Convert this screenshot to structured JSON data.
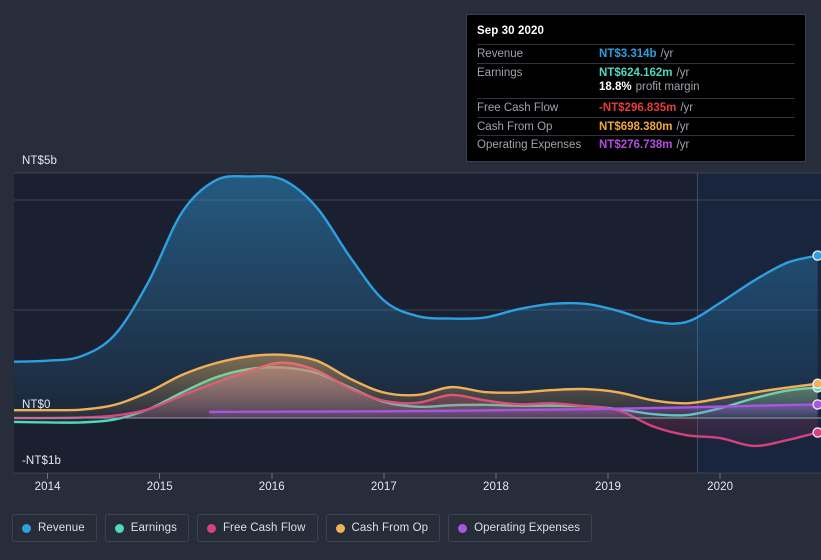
{
  "chart_data": {
    "type": "area",
    "title": "",
    "xlabel": "",
    "ylabel": "",
    "currency": "NT$",
    "grid": true,
    "legend_position": "bottom",
    "x_ticks": [
      "2014",
      "2015",
      "2016",
      "2017",
      "2018",
      "2019",
      "2020"
    ],
    "y_ticks": [
      "NT$5b",
      "NT$0",
      "-NT$1b"
    ],
    "ylim": [
      -1.0,
      5.0
    ],
    "xlim": [
      2013.7,
      2020.9
    ],
    "forecast_divider_x": "2019.8",
    "series": [
      {
        "name": "Revenue",
        "color": "#2e9fe0",
        "x": [
          2013.7,
          2014.0,
          2014.3,
          2014.6,
          2014.9,
          2015.2,
          2015.5,
          2015.8,
          2016.1,
          2016.4,
          2016.7,
          2017.0,
          2017.3,
          2017.6,
          2017.9,
          2018.2,
          2018.5,
          2018.8,
          2019.1,
          2019.4,
          2019.7,
          2020.0,
          2020.3,
          2020.6,
          2020.87
        ],
        "values": [
          1.15,
          1.17,
          1.26,
          1.7,
          2.78,
          4.2,
          4.85,
          4.93,
          4.86,
          4.3,
          3.28,
          2.4,
          2.08,
          2.03,
          2.05,
          2.22,
          2.33,
          2.33,
          2.18,
          1.97,
          1.96,
          2.35,
          2.8,
          3.17,
          3.314
        ],
        "end_value": 3.314
      },
      {
        "name": "Earnings",
        "color": "#4fd8bd",
        "x": [
          2013.7,
          2014.0,
          2014.3,
          2014.6,
          2014.9,
          2015.2,
          2015.5,
          2015.8,
          2016.1,
          2016.4,
          2016.7,
          2017.0,
          2017.3,
          2017.6,
          2017.9,
          2018.2,
          2018.5,
          2018.8,
          2019.1,
          2019.4,
          2019.7,
          2020.0,
          2020.3,
          2020.6,
          2020.87
        ],
        "values": [
          -0.08,
          -0.09,
          -0.09,
          -0.03,
          0.18,
          0.52,
          0.83,
          1.0,
          1.03,
          0.92,
          0.62,
          0.33,
          0.23,
          0.26,
          0.27,
          0.25,
          0.25,
          0.24,
          0.18,
          0.08,
          0.06,
          0.2,
          0.4,
          0.56,
          0.624162
        ],
        "end_value": 0.624162
      },
      {
        "name": "Free Cash Flow",
        "color": "#d6407f",
        "x": [
          2013.7,
          2014.0,
          2014.3,
          2014.6,
          2014.9,
          2015.2,
          2015.5,
          2015.8,
          2016.1,
          2016.4,
          2016.7,
          2017.0,
          2017.3,
          2017.6,
          2017.9,
          2018.2,
          2018.5,
          2018.8,
          2019.1,
          2019.4,
          2019.7,
          2020.0,
          2020.3,
          2020.6,
          2020.87
        ],
        "values": [
          0.0,
          0.0,
          0.01,
          0.05,
          0.18,
          0.46,
          0.72,
          0.96,
          1.13,
          0.97,
          0.6,
          0.35,
          0.31,
          0.47,
          0.36,
          0.28,
          0.3,
          0.24,
          0.15,
          -0.17,
          -0.35,
          -0.41,
          -0.57,
          -0.45,
          -0.296835
        ],
        "end_value": -0.296835
      },
      {
        "name": "Cash From Op",
        "color": "#f0b05a",
        "x": [
          2013.7,
          2014.0,
          2014.3,
          2014.6,
          2014.9,
          2015.2,
          2015.5,
          2015.8,
          2016.1,
          2016.4,
          2016.7,
          2017.0,
          2017.3,
          2017.6,
          2017.9,
          2018.2,
          2018.5,
          2018.8,
          2019.1,
          2019.4,
          2019.7,
          2020.0,
          2020.3,
          2020.6,
          2020.87
        ],
        "values": [
          0.16,
          0.16,
          0.17,
          0.27,
          0.53,
          0.88,
          1.12,
          1.26,
          1.29,
          1.17,
          0.8,
          0.52,
          0.47,
          0.63,
          0.53,
          0.52,
          0.57,
          0.59,
          0.52,
          0.36,
          0.3,
          0.4,
          0.52,
          0.62,
          0.69838
        ],
        "end_value": 0.69838
      },
      {
        "name": "Operating Expenses",
        "color": "#a855e0",
        "x": [
          2015.45,
          2015.8,
          2016.1,
          2016.4,
          2016.7,
          2017.0,
          2017.3,
          2017.6,
          2017.9,
          2018.2,
          2018.5,
          2018.8,
          2019.1,
          2019.4,
          2019.7,
          2020.0,
          2020.3,
          2020.6,
          2020.87
        ],
        "values": [
          0.125,
          0.128,
          0.13,
          0.132,
          0.134,
          0.137,
          0.142,
          0.148,
          0.155,
          0.164,
          0.172,
          0.18,
          0.192,
          0.204,
          0.216,
          0.232,
          0.25,
          0.265,
          0.276738
        ],
        "end_value": 0.276738
      }
    ]
  },
  "tooltip": {
    "date": "Sep 30 2020",
    "rows": [
      {
        "key": "Revenue",
        "value": "NT$3.314b",
        "suffix": "/yr",
        "color": "#2e9fe0"
      },
      {
        "key": "Earnings",
        "value": "NT$624.162m",
        "suffix": "/yr",
        "color": "#4fd8bd"
      },
      {
        "key": "",
        "value": "18.8%",
        "suffix": "profit margin",
        "color": "#ffffff"
      },
      {
        "key": "Free Cash Flow",
        "value": "-NT$296.835m",
        "suffix": "/yr",
        "color": "#e63b3b"
      },
      {
        "key": "Cash From Op",
        "value": "NT$698.380m",
        "suffix": "/yr",
        "color": "#f0a73a"
      },
      {
        "key": "Operating Expenses",
        "value": "NT$276.738m",
        "suffix": "/yr",
        "color": "#b54ce0"
      }
    ]
  },
  "legend": {
    "items": [
      {
        "label": "Revenue",
        "color": "#2e9fe0"
      },
      {
        "label": "Earnings",
        "color": "#4fd8bd"
      },
      {
        "label": "Free Cash Flow",
        "color": "#d6407f"
      },
      {
        "label": "Cash From Op",
        "color": "#f0b05a"
      },
      {
        "label": "Operating Expenses",
        "color": "#a855e0"
      }
    ]
  },
  "axis": {
    "y_top": "NT$5b",
    "y_zero": "NT$0",
    "y_bottom": "-NT$1b"
  },
  "colors": {
    "page_background": "#282d3b",
    "plot_background": "#1b2030",
    "forecast_background": "#19253c",
    "gridline": "#3b4250",
    "zero_line": "#9aa0ad"
  }
}
